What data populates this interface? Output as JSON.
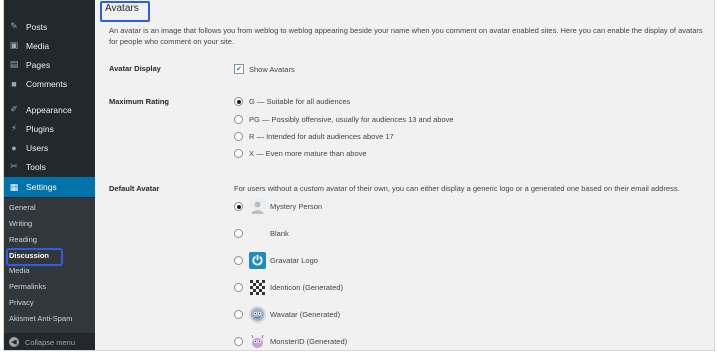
{
  "sidebar": {
    "menu": [
      {
        "label": "Posts",
        "icon": "pushpin-icon"
      },
      {
        "label": "Media",
        "icon": "media-icon"
      },
      {
        "label": "Pages",
        "icon": "page-icon"
      },
      {
        "label": "Comments",
        "icon": "comment-icon"
      },
      {
        "label": "Appearance",
        "icon": "paintbrush-icon"
      },
      {
        "label": "Plugins",
        "icon": "plug-icon"
      },
      {
        "label": "Users",
        "icon": "users-icon"
      },
      {
        "label": "Tools",
        "icon": "wrench-icon"
      },
      {
        "label": "Settings",
        "icon": "settings-icon"
      }
    ],
    "submenu": [
      "General",
      "Writing",
      "Reading",
      "Discussion",
      "Media",
      "Permalinks",
      "Privacy",
      "Akismet Anti-Spam"
    ],
    "collapse_label": "Collapse menu"
  },
  "main": {
    "title": "Avatars",
    "description": "An avatar is an image that follows you from weblog to weblog appearing beside your name when you comment on avatar enabled sites. Here you can enable the display of avatars for people who comment on your site.",
    "avatar_display": {
      "label": "Avatar Display",
      "option": "Show Avatars",
      "checked": true
    },
    "max_rating": {
      "label": "Maximum Rating",
      "options": [
        "G — Suitable for all audiences",
        "PG — Possibly offensive, usually for audiences 13 and above",
        "R — Intended for adult audiences above 17",
        "X — Even more mature than above"
      ],
      "selected": 0
    },
    "default_avatar": {
      "label": "Default Avatar",
      "description": "For users without a custom avatar of their own, you can either display a generic logo or a generated one based on their email address.",
      "options": [
        "Mystery Person",
        "Blank",
        "Gravatar Logo",
        "Identicon (Generated)",
        "Wavatar (Generated)",
        "MonsterID (Generated)"
      ],
      "selected": 0
    }
  },
  "colors": {
    "sidebar": "#23282d",
    "submenu": "#32373c",
    "active": "#0073aa",
    "highlight": "#2f5fe0"
  }
}
